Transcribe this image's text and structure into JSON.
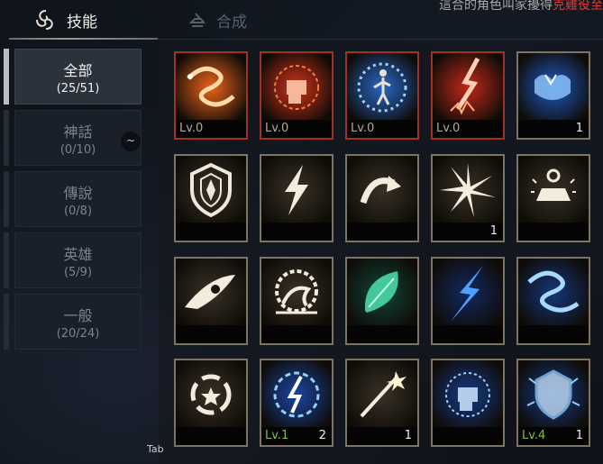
{
  "tabs": [
    {
      "label": "技能",
      "icon": "skill-swirl-icon",
      "active": true
    },
    {
      "label": "合成",
      "icon": "anvil-icon",
      "active": false
    }
  ],
  "top_right": {
    "white": "這合的角色叫家擾得",
    "red": "克雞役至"
  },
  "categories": [
    {
      "name": "全部",
      "count": "(25/51)",
      "active": true
    },
    {
      "name": "神話",
      "count": "(0/10)",
      "active": false
    },
    {
      "name": "傳說",
      "count": "(0/8)",
      "active": false
    },
    {
      "name": "英雄",
      "count": "(5/9)",
      "active": false
    },
    {
      "name": "一般",
      "count": "(20/24)",
      "active": false
    }
  ],
  "tilde": "~",
  "tab_key": "Tab",
  "skills": [
    [
      {
        "icon": "lightning-serpent-icon",
        "level": "Lv.0",
        "count": ""
      },
      {
        "icon": "fire-fist-icon",
        "level": "Lv.0",
        "count": ""
      },
      {
        "icon": "lightning-warrior-icon",
        "level": "Lv.0",
        "count": ""
      },
      {
        "icon": "red-lightning-strike-icon",
        "level": "Lv.0",
        "count": ""
      },
      {
        "icon": "electric-muscle-icon",
        "level": "",
        "count": "1"
      }
    ],
    [
      {
        "icon": "shield-icon",
        "level": "",
        "count": ""
      },
      {
        "icon": "lightning-bolt-icon",
        "level": "",
        "count": ""
      },
      {
        "icon": "curved-arrow-icon",
        "level": "",
        "count": ""
      },
      {
        "icon": "burst-star-icon",
        "level": "",
        "count": "1"
      },
      {
        "icon": "anvil-sparkle-icon",
        "level": "",
        "count": ""
      }
    ],
    [
      {
        "icon": "eye-icon",
        "level": "",
        "count": ""
      },
      {
        "icon": "spiky-crest-icon",
        "level": "",
        "count": ""
      },
      {
        "icon": "green-leaf-icon",
        "level": "",
        "count": ""
      },
      {
        "icon": "blue-bolt-icon",
        "level": "",
        "count": ""
      },
      {
        "icon": "blue-serpent-icon",
        "level": "",
        "count": ""
      }
    ],
    [
      {
        "icon": "circle-star-icon",
        "level": "",
        "count": ""
      },
      {
        "icon": "blue-orb-bolt-icon",
        "level": "Lv.1",
        "count": "2"
      },
      {
        "icon": "arrow-burst-icon",
        "level": "",
        "count": "1"
      },
      {
        "icon": "blue-fist-icon",
        "level": "",
        "count": ""
      },
      {
        "icon": "electric-shield-icon",
        "level": "Lv.4",
        "count": "1"
      }
    ]
  ]
}
